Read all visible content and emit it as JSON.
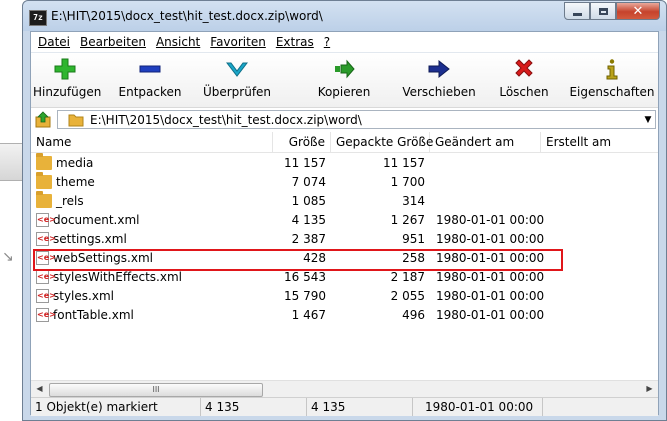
{
  "window": {
    "title": "E:\\HIT\\2015\\docx_test\\hit_test.docx.zip\\word\\",
    "app_icon": "7z"
  },
  "menu": [
    "Datei",
    "Bearbeiten",
    "Ansicht",
    "Favoriten",
    "Extras",
    "?"
  ],
  "toolbar": [
    {
      "label": "Hinzufügen",
      "icon": "plus-icon",
      "color": "#2fb52f"
    },
    {
      "label": "Entpacken",
      "icon": "minus-icon",
      "color": "#1f3fbf"
    },
    {
      "label": "Überprüfen",
      "icon": "check-icon",
      "color": "#1aa6c8"
    },
    {
      "label": "Kopieren",
      "icon": "copy-arrow-icon",
      "color": "#2a9a2a"
    },
    {
      "label": "Verschieben",
      "icon": "arrow-right-icon",
      "color": "#1c2f8f"
    },
    {
      "label": "Löschen",
      "icon": "delete-x-icon",
      "color": "#d81b1b"
    },
    {
      "label": "Eigenschaften",
      "icon": "info-icon",
      "color": "#8a7a00"
    }
  ],
  "address": {
    "path": "E:\\HIT\\2015\\docx_test\\hit_test.docx.zip\\word\\"
  },
  "columns": {
    "name": "Name",
    "size": "Größe",
    "packed": "Gepackte Größe",
    "modified": "Geändert am",
    "created": "Erstellt am"
  },
  "files": [
    {
      "name": "media",
      "type": "folder",
      "size": "11 157",
      "packed": "11 157",
      "modified": ""
    },
    {
      "name": "theme",
      "type": "folder",
      "size": "7 074",
      "packed": "1 700",
      "modified": ""
    },
    {
      "name": "_rels",
      "type": "folder",
      "size": "1 085",
      "packed": "314",
      "modified": ""
    },
    {
      "name": "document.xml",
      "type": "xml",
      "size": "4 135",
      "packed": "1 267",
      "modified": "1980-01-01 00:00"
    },
    {
      "name": "settings.xml",
      "type": "xml",
      "size": "2 387",
      "packed": "951",
      "modified": "1980-01-01 00:00"
    },
    {
      "name": "webSettings.xml",
      "type": "xml",
      "size": "428",
      "packed": "258",
      "modified": "1980-01-01 00:00"
    },
    {
      "name": "stylesWithEffects.xml",
      "type": "xml",
      "size": "16 543",
      "packed": "2 187",
      "modified": "1980-01-01 00:00"
    },
    {
      "name": "styles.xml",
      "type": "xml",
      "size": "15 790",
      "packed": "2 055",
      "modified": "1980-01-01 00:00"
    },
    {
      "name": "fontTable.xml",
      "type": "xml",
      "size": "1 467",
      "packed": "496",
      "modified": "1980-01-01 00:00"
    }
  ],
  "status": {
    "selected": "1 Objekt(e) markiert",
    "size": "4 135",
    "packed": "4 135",
    "modified": "1980-01-01 00:00"
  },
  "scroll_thumb": "III",
  "colors": {
    "highlight": "#e0161a",
    "folder": "#e8b23a",
    "xml_icon": "#d02020"
  }
}
